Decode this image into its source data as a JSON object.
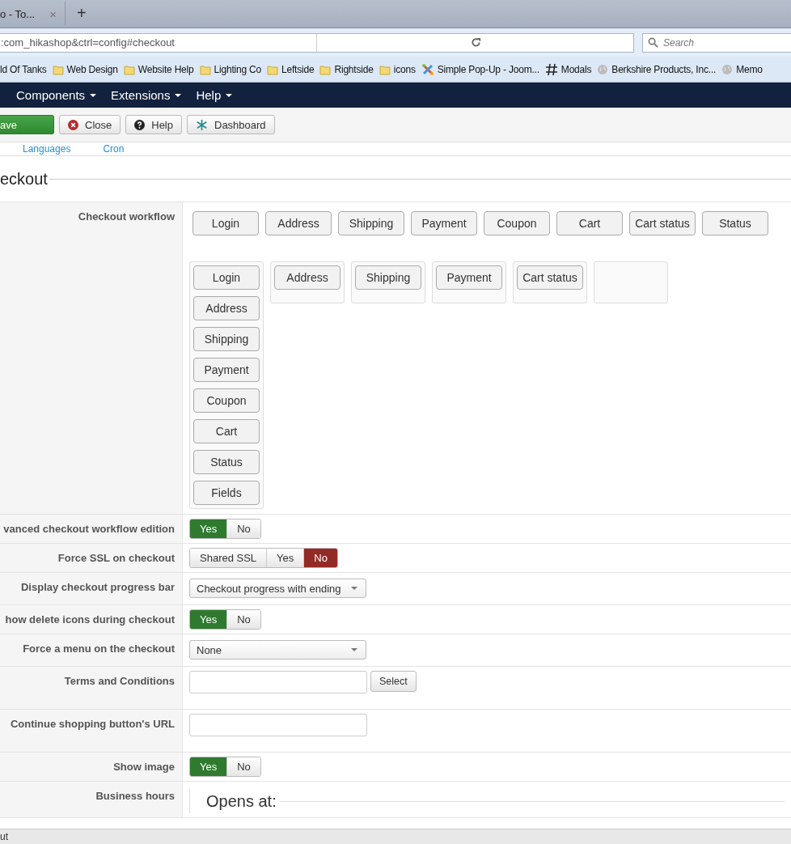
{
  "browser": {
    "tab": {
      "title": "o - To...",
      "close": "×"
    },
    "new_tab": "+",
    "url": ":com_hikashop&ctrl=config#checkout",
    "search": {
      "placeholder": "Search"
    },
    "bookmarks": [
      {
        "label": "ld Of Tanks",
        "kind": "none"
      },
      {
        "label": "Web Design",
        "kind": "folder"
      },
      {
        "label": "Website Help",
        "kind": "folder"
      },
      {
        "label": "Lighting Co",
        "kind": "folder"
      },
      {
        "label": "Leftside",
        "kind": "folder"
      },
      {
        "label": "Rightside",
        "kind": "folder"
      },
      {
        "label": "icons",
        "kind": "folder"
      },
      {
        "label": "Simple Pop-Up - Joom...",
        "kind": "logo"
      },
      {
        "label": "Modals",
        "kind": "hash"
      },
      {
        "label": "Berkshire Products, Inc...",
        "kind": "globe"
      },
      {
        "label": "Memo",
        "kind": "globe"
      }
    ]
  },
  "menu": [
    "Components",
    "Extensions",
    "Help"
  ],
  "toolbar": [
    {
      "label": "ave",
      "kind": "save"
    },
    {
      "label": "Close",
      "kind": "close"
    },
    {
      "label": "Help",
      "kind": "help"
    },
    {
      "label": "Dashboard",
      "kind": "dashboard"
    }
  ],
  "subnav": [
    "Languages",
    "Cron"
  ],
  "section_title": "eckout",
  "workflow": {
    "label": "Checkout workflow",
    "available": [
      "Login",
      "Address",
      "Shipping",
      "Payment",
      "Coupon",
      "Cart",
      "Cart status",
      "Status"
    ],
    "columns": [
      [
        "Login",
        "Address",
        "Shipping",
        "Payment",
        "Coupon",
        "Cart",
        "Status",
        "Fields"
      ],
      [
        "Address"
      ],
      [
        "Shipping"
      ],
      [
        "Payment"
      ],
      [
        "Cart status"
      ],
      []
    ]
  },
  "settings": [
    {
      "label": "vanced checkout workflow edition",
      "kind": "toggle",
      "options": [
        {
          "label": "Yes",
          "selected": true,
          "color": "#2f7a2f"
        },
        {
          "label": "No",
          "selected": false
        }
      ]
    },
    {
      "label": "Force SSL on checkout",
      "kind": "toggle",
      "options": [
        {
          "label": "Shared SSL",
          "selected": false
        },
        {
          "label": "Yes",
          "selected": false
        },
        {
          "label": "No",
          "selected": true,
          "color": "#942a25"
        }
      ]
    },
    {
      "label": "Display checkout progress bar",
      "kind": "select",
      "value": "Checkout progress with ending"
    },
    {
      "label": "how delete icons during checkout",
      "kind": "toggle",
      "options": [
        {
          "label": "Yes",
          "selected": true,
          "color": "#2f7a2f"
        },
        {
          "label": "No",
          "selected": false
        }
      ]
    },
    {
      "label": "Force a menu on the checkout",
      "kind": "select",
      "value": "None"
    },
    {
      "label": "Terms and Conditions",
      "kind": "input_button",
      "button": "Select"
    },
    {
      "label": "Continue shopping button's URL",
      "kind": "input"
    },
    {
      "label": "Show image",
      "kind": "toggle",
      "options": [
        {
          "label": "Yes",
          "selected": true,
          "color": "#2f7a2f"
        },
        {
          "label": "No",
          "selected": false
        }
      ]
    },
    {
      "label": "Business hours",
      "kind": "fieldset",
      "legend": "Opens at:"
    }
  ],
  "status_bar": "ut"
}
